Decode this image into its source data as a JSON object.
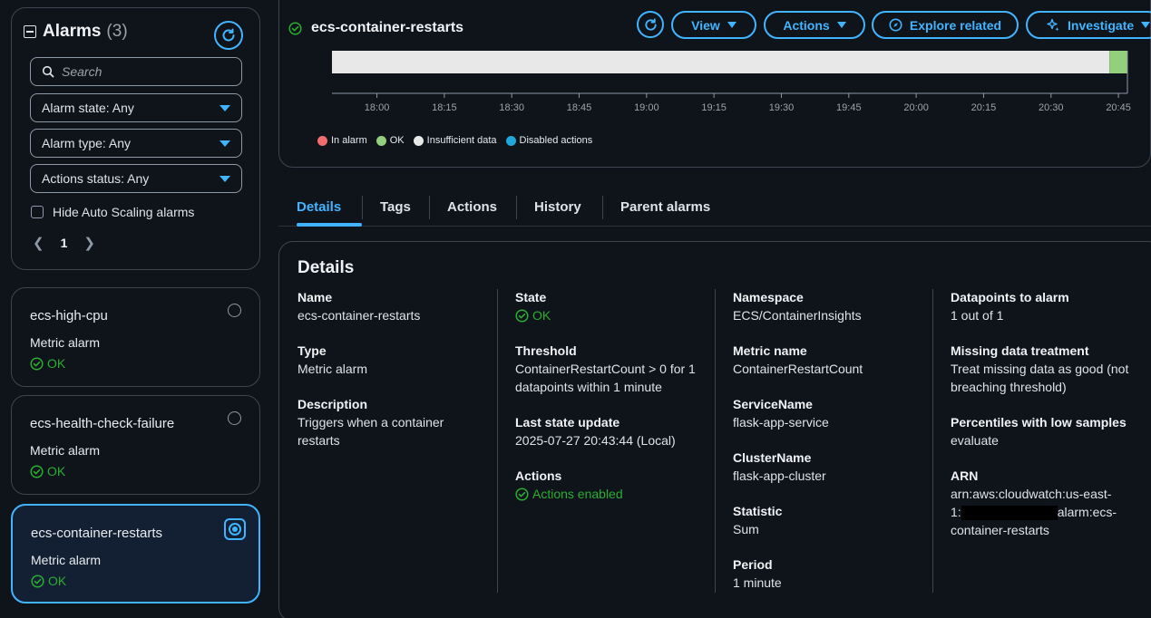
{
  "sidebar": {
    "title": "Alarms",
    "count": "(3)",
    "search_placeholder": "Search",
    "filters": [
      "Alarm state: Any",
      "Alarm type: Any",
      "Actions status: Any"
    ],
    "hide_autoscaling_label": "Hide Auto Scaling alarms",
    "page": "1"
  },
  "alarms": [
    {
      "name": "ecs-high-cpu",
      "type": "Metric alarm",
      "status": "OK",
      "selected": false
    },
    {
      "name": "ecs-health-check-failure",
      "type": "Metric alarm",
      "status": "OK",
      "selected": false
    },
    {
      "name": "ecs-container-restarts",
      "type": "Metric alarm",
      "status": "OK",
      "selected": true
    }
  ],
  "header": {
    "title": "ecs-container-restarts",
    "view_label": "View",
    "actions_label": "Actions",
    "explore_label": "Explore related",
    "investigate_label": "Investigate"
  },
  "chart_data": {
    "type": "timeline",
    "x_ticks": [
      "18:00",
      "18:15",
      "18:30",
      "18:45",
      "19:00",
      "19:15",
      "19:30",
      "19:45",
      "20:00",
      "20:15",
      "20:30",
      "20:45"
    ],
    "segments": [
      {
        "state": "Insufficient data",
        "start": "17:50",
        "end": "20:43"
      },
      {
        "state": "OK",
        "start": "20:43",
        "end": "20:47"
      }
    ],
    "legend": [
      "In alarm",
      "OK",
      "Insufficient data",
      "Disabled actions"
    ],
    "colors": {
      "In alarm": "#f06d6d",
      "OK": "#92d07c",
      "Insufficient data": "#e8e8e8",
      "Disabled actions": "#1ea7d8"
    }
  },
  "tabs": [
    "Details",
    "Tags",
    "Actions",
    "History",
    "Parent alarms"
  ],
  "details": {
    "title": "Details",
    "col1": [
      {
        "label": "Name",
        "value": "ecs-container-restarts"
      },
      {
        "label": "Type",
        "value": "Metric alarm"
      },
      {
        "label": "Description",
        "value": "Triggers when a container restarts"
      }
    ],
    "col2": [
      {
        "label": "State",
        "value": "OK"
      },
      {
        "label": "Threshold",
        "value": "ContainerRestartCount > 0 for 1 datapoints within 1 minute"
      },
      {
        "label": "Last state update",
        "value": "2025-07-27 20:43:44 (Local)"
      },
      {
        "label": "Actions",
        "value": "Actions enabled"
      }
    ],
    "col3": [
      {
        "label": "Namespace",
        "value": "ECS/ContainerInsights"
      },
      {
        "label": "Metric name",
        "value": "ContainerRestartCount"
      },
      {
        "label": "ServiceName",
        "value": "flask-app-service"
      },
      {
        "label": "ClusterName",
        "value": "flask-app-cluster"
      },
      {
        "label": "Statistic",
        "value": "Sum"
      },
      {
        "label": "Period",
        "value": "1 minute"
      }
    ],
    "col4": [
      {
        "label": "Datapoints to alarm",
        "value": "1 out of 1"
      },
      {
        "label": "Missing data treatment",
        "value": "Treat missing data as good (not breaching threshold)"
      },
      {
        "label": "Percentiles with low samples",
        "value": "evaluate"
      },
      {
        "label": "ARN",
        "value_prefix": "arn:aws:cloudwatch:us-east-1:",
        "value_suffix": "alarm:ecs-container-restarts"
      }
    ]
  }
}
